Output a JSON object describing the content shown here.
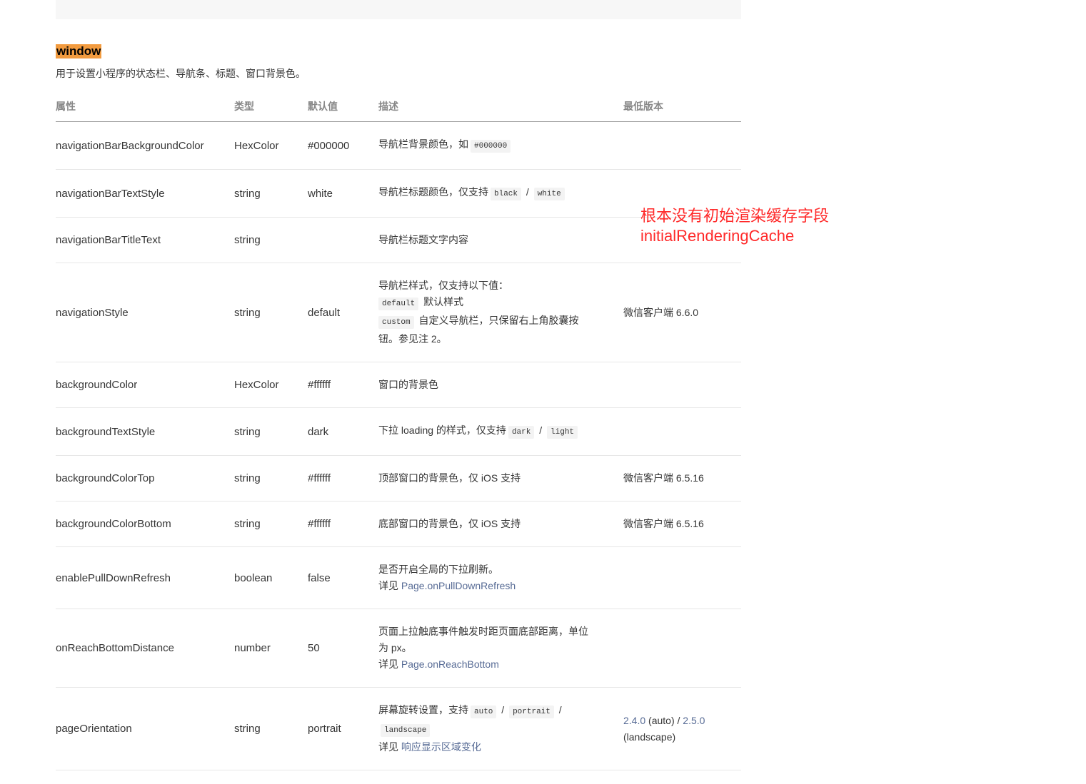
{
  "section": {
    "title": "window",
    "description": "用于设置小程序的状态栏、导航条、标题、窗口背景色。"
  },
  "table": {
    "headers": {
      "property": "属性",
      "type": "类型",
      "default": "默认值",
      "description": "描述",
      "min_version": "最低版本"
    },
    "rows": [
      {
        "property": "navigationBarBackgroundColor",
        "type": "HexColor",
        "default": "#000000",
        "desc": [
          "导航栏背景颜色，如",
          "#000000"
        ]
      },
      {
        "property": "navigationBarTextStyle",
        "type": "string",
        "default": "white",
        "desc": [
          "导航栏标题颜色，仅支持",
          "black",
          "/",
          "white"
        ]
      },
      {
        "property": "navigationBarTitleText",
        "type": "string",
        "desc": [
          "导航栏标题文字内容"
        ]
      },
      {
        "property": "navigationStyle",
        "type": "string",
        "default": "default",
        "desc": [
          "导航栏样式，仅支持以下值：",
          "default",
          "默认样式",
          "custom",
          "自定义导航栏，只保留右上角胶囊按钮。参见注 2。"
        ],
        "min_version": "微信客户端 6.6.0"
      },
      {
        "property": "backgroundColor",
        "type": "HexColor",
        "default": "#ffffff",
        "desc": [
          "窗口的背景色"
        ]
      },
      {
        "property": "backgroundTextStyle",
        "type": "string",
        "default": "dark",
        "desc": [
          "下拉 loading 的样式，仅支持",
          "dark",
          "/",
          "light"
        ]
      },
      {
        "property": "backgroundColorTop",
        "type": "string",
        "default": "#ffffff",
        "desc": [
          "顶部窗口的背景色，仅 iOS 支持"
        ],
        "min_version": "微信客户端 6.5.16"
      },
      {
        "property": "backgroundColorBottom",
        "type": "string",
        "default": "#ffffff",
        "desc": [
          "底部窗口的背景色，仅 iOS 支持"
        ],
        "min_version": "微信客户端 6.5.16"
      },
      {
        "property": "enablePullDownRefresh",
        "type": "boolean",
        "default": "false",
        "desc": [
          "是否开启全局的下拉刷新。",
          "详见",
          "Page.onPullDownRefresh"
        ]
      },
      {
        "property": "onReachBottomDistance",
        "type": "number",
        "default": "50",
        "desc": [
          "页面上拉触底事件触发时距页面底部距离，单位为 px。",
          "详见",
          "Page.onReachBottom"
        ]
      },
      {
        "property": "pageOrientation",
        "type": "string",
        "default": "portrait",
        "desc": [
          "屏幕旋转设置，支持",
          "auto",
          "/",
          "portrait",
          "/",
          "landscape",
          "详见",
          "响应显示区域变化"
        ],
        "min_version": [
          "2.4.0",
          "(auto) /",
          "2.5.0",
          "(landscape)"
        ]
      }
    ]
  },
  "annotation": {
    "lines": [
      "根本没有初始渲染缓存字段",
      "initialRenderingCache"
    ]
  },
  "colors": {
    "text": "#353535",
    "header_text": "#888888",
    "link": "#576b95",
    "title_highlight": "#f29b3f",
    "annotation": "#ff2a2a",
    "code_bg": "#f3f3f3"
  }
}
